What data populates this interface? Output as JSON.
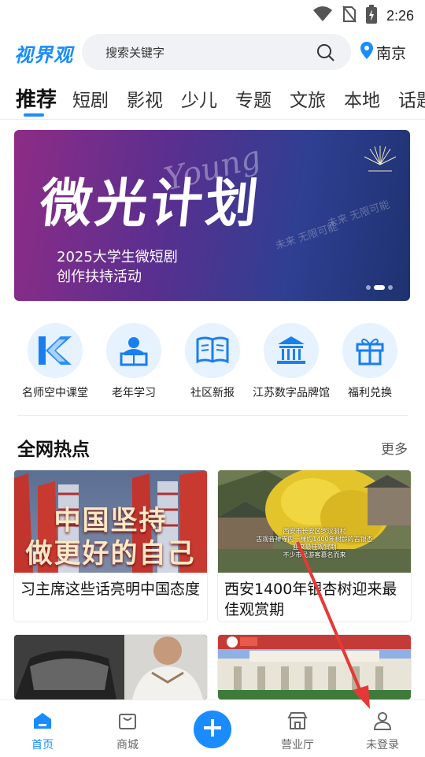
{
  "status": {
    "time": "2:26"
  },
  "header": {
    "logo": "视界观",
    "search_placeholder": "搜索关键字",
    "city": "南京"
  },
  "tabs": [
    "推荐",
    "短剧",
    "影视",
    "少儿",
    "专题",
    "文旅",
    "本地",
    "话题"
  ],
  "banner": {
    "title": "微光计划",
    "overlay": "Young",
    "subtitle_line1": "2025大学生微短剧",
    "subtitle_line2": "创作扶持活动",
    "deco1": "未来 无限可能",
    "deco2": "未来 无限可能"
  },
  "quick_links": [
    {
      "label": "名师空中课堂",
      "icon": "k-logo-icon"
    },
    {
      "label": "老年学习",
      "icon": "reading-person-icon"
    },
    {
      "label": "社区新报",
      "icon": "open-book-icon"
    },
    {
      "label": "江苏数字品牌馆",
      "icon": "pavilion-icon"
    },
    {
      "label": "福利兑换",
      "icon": "gift-icon"
    }
  ],
  "section": {
    "title": "全网热点",
    "more": "更多"
  },
  "cards": [
    {
      "title": "习主席这些话亮明中国态度",
      "thumb_text_1": "中国坚持",
      "thumb_text_2": "做更好的自己"
    },
    {
      "title": "西安1400年银杏树迎来最佳观赏期",
      "caption_1": "西安市长安区罗汉洞村",
      "caption_2": "古观音禅寺内一棵约1400年树龄的古银杏",
      "caption_3": "迎来最佳观赏期",
      "caption_4": "不少市民游客慕名而来"
    },
    {
      "title": ""
    },
    {
      "title": ""
    }
  ],
  "nav": [
    {
      "label": "首页",
      "active": true
    },
    {
      "label": "商城",
      "active": false
    },
    {
      "label": "",
      "active": false
    },
    {
      "label": "营业厅",
      "active": false
    },
    {
      "label": "未登录",
      "active": false
    }
  ],
  "colors": {
    "accent": "#1a8cff",
    "annotation": "#e53935"
  }
}
